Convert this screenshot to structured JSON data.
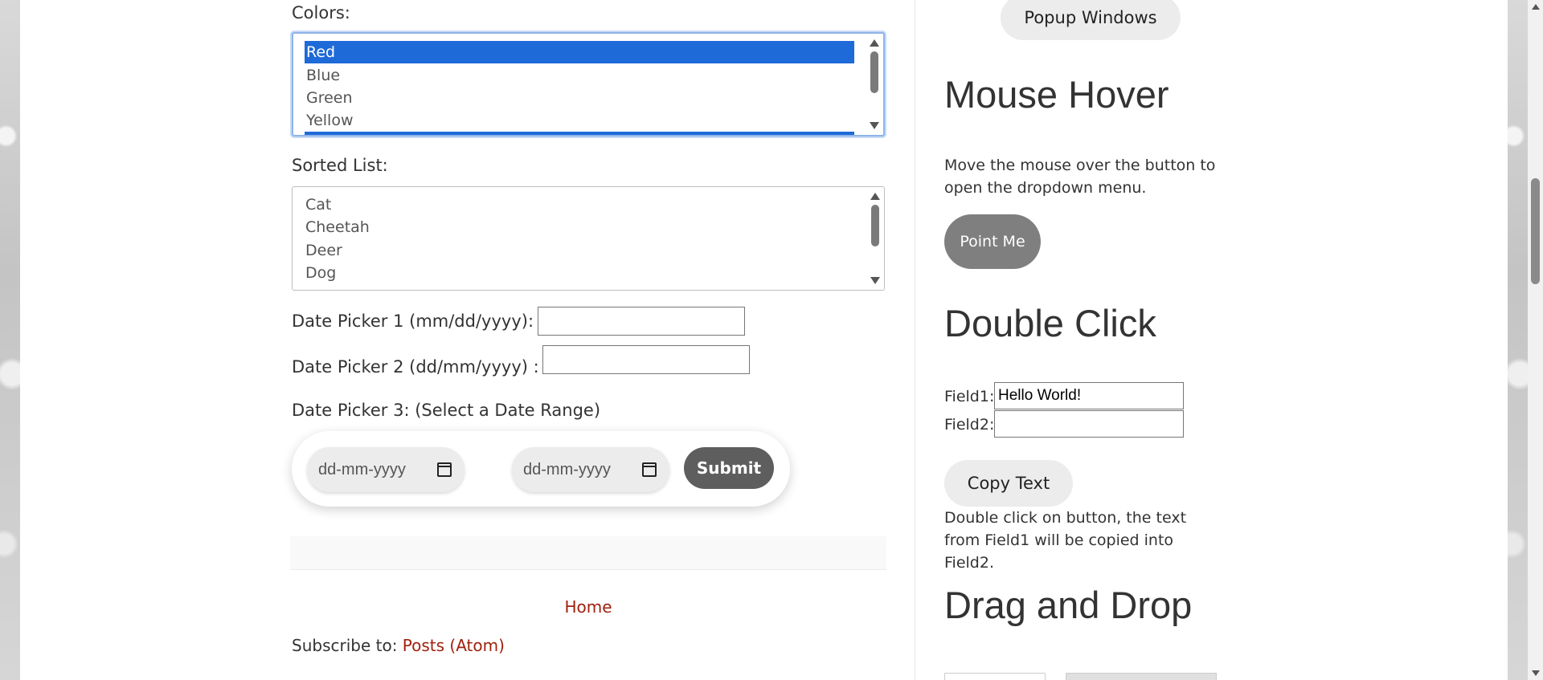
{
  "form": {
    "colors_label": "Colors:",
    "colors_options": [
      "Red",
      "Blue",
      "Green",
      "Yellow"
    ],
    "colors_selected": "Red",
    "sorted_label": "Sorted List:",
    "sorted_options": [
      "Cat",
      "Cheetah",
      "Deer",
      "Dog"
    ],
    "date_picker_1_label": "Date Picker 1 (mm/dd/yyyy):",
    "date_picker_1_value": "",
    "date_picker_2_label": "Date Picker 2 (dd/mm/yyyy) :",
    "date_picker_2_value": "",
    "date_picker_3_label": "Date Picker 3: (Select a Date Range)",
    "range_start_placeholder": "dd-mm-yyyy",
    "range_end_placeholder": "dd-mm-yyyy",
    "submit_label": "Submit"
  },
  "footer": {
    "home_link": "Home",
    "subscribe_prefix": "Subscribe to: ",
    "subscribe_link": "Posts (Atom)"
  },
  "sidebar": {
    "popup_button": "Popup Windows",
    "mouse_hover_title": "Mouse Hover",
    "mouse_hover_desc": "Move the mouse over the button to open the dropdown menu.",
    "point_me_button": "Point Me",
    "double_click_title": "Double Click",
    "field1_label": "Field1:",
    "field1_value": "Hello World!",
    "field2_label": "Field2:",
    "field2_value": "",
    "copy_text_button": "Copy Text",
    "double_click_desc": "Double click on button, the text from Field1 will be copied into Field2.",
    "drag_drop_title": "Drag and Drop"
  },
  "colors": {
    "selection": "#1e6ad8",
    "link": "#a0210e",
    "submit_bg": "#5e5e5e",
    "point_me_bg": "#7f7f7f"
  }
}
